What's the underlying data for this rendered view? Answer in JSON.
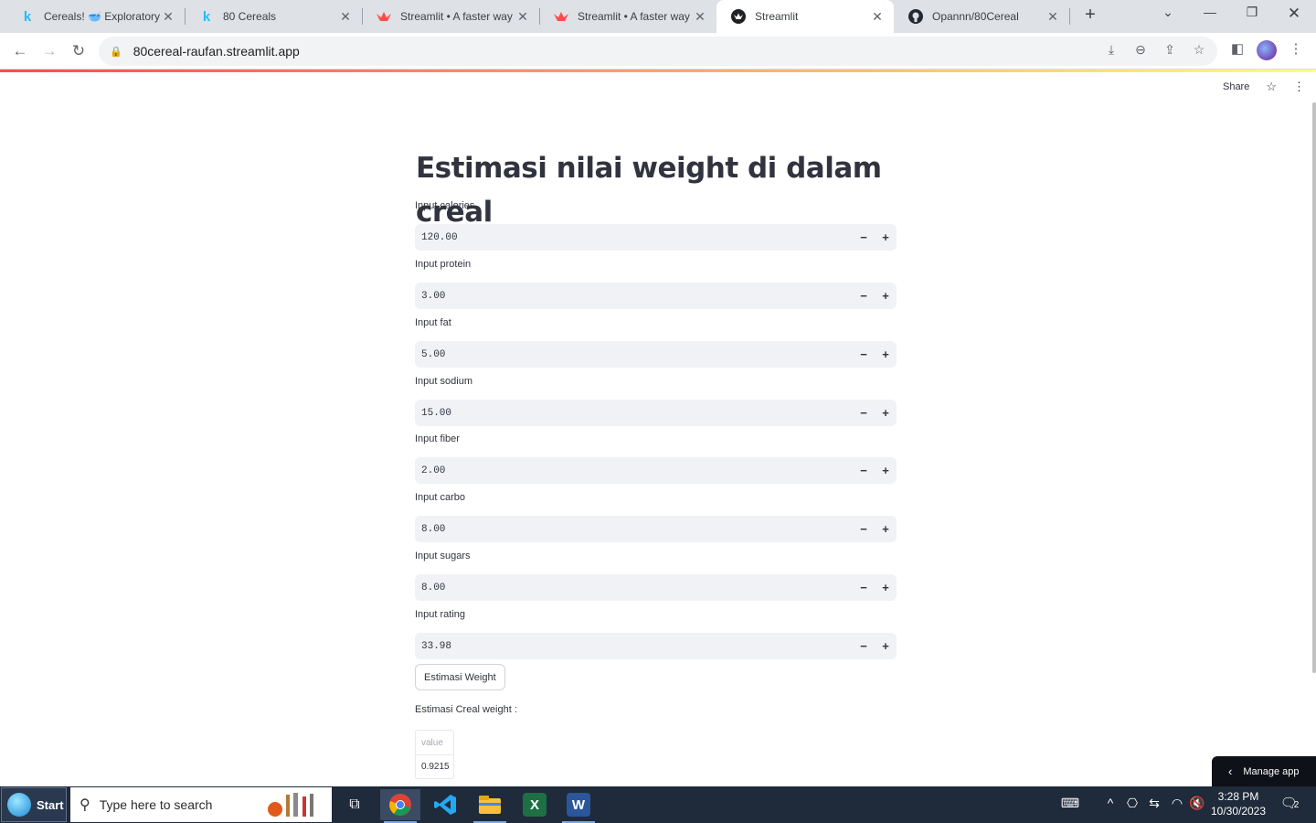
{
  "browser": {
    "tabs": [
      {
        "title": "Cereals! 🥣 Exploratory",
        "favicon": "kaggle-icon"
      },
      {
        "title": "80 Cereals",
        "favicon": "kaggle-icon"
      },
      {
        "title": "Streamlit • A faster way",
        "favicon": "streamlit-icon"
      },
      {
        "title": "Streamlit • A faster way",
        "favicon": "streamlit-icon"
      },
      {
        "title": "Streamlit",
        "favicon": "streamlit-dark-icon"
      },
      {
        "title": "Opannn/80Cereal",
        "favicon": "github-icon"
      }
    ],
    "active_tab": 4,
    "url": "80cereal-raufan.streamlit.app",
    "accent_gradient": [
      "#ff4b4b",
      "#ffa36e",
      "#fffd80"
    ]
  },
  "header": {
    "share_label": "Share"
  },
  "main": {
    "title": "Estimasi nilai weight di dalam creal",
    "fields": [
      {
        "label": "Input calories",
        "value": "120.00"
      },
      {
        "label": "Input protein",
        "value": "3.00"
      },
      {
        "label": "Input fat",
        "value": "5.00"
      },
      {
        "label": "Input sodium",
        "value": "15.00"
      },
      {
        "label": "Input fiber",
        "value": "2.00"
      },
      {
        "label": "Input carbo",
        "value": "8.00"
      },
      {
        "label": "Input sugars",
        "value": "8.00"
      },
      {
        "label": "Input rating",
        "value": "33.98"
      }
    ],
    "stepper_minus": "−",
    "stepper_plus": "+",
    "button_label": "Estimasi Weight",
    "result_label": "Estimasi Creal weight :",
    "result_table": {
      "header": "value",
      "value": "0.9215"
    }
  },
  "manage_app": {
    "label": "Manage app"
  },
  "taskbar": {
    "start_label": "Start",
    "search_placeholder": "Type here to search",
    "time": "3:28 PM",
    "date": "10/30/2023",
    "notification_count": "2"
  }
}
